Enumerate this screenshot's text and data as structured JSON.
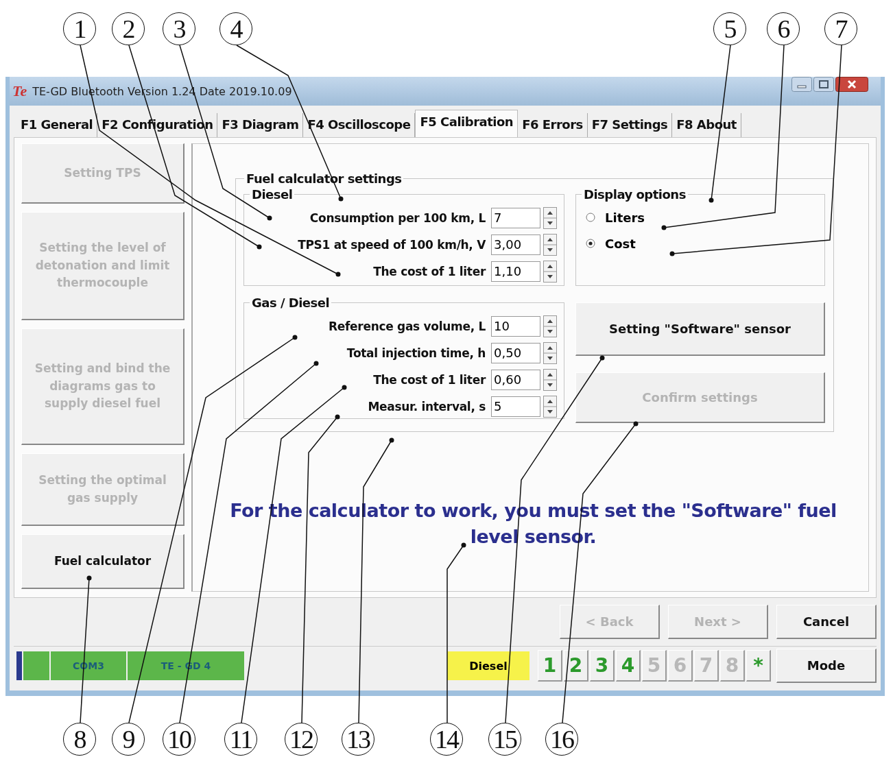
{
  "callouts_top": [
    {
      "label": "1"
    },
    {
      "label": "2"
    },
    {
      "label": "3"
    },
    {
      "label": "4"
    },
    {
      "label": "5"
    },
    {
      "label": "6"
    },
    {
      "label": "7"
    }
  ],
  "callouts_bottom": [
    {
      "label": "8"
    },
    {
      "label": "9"
    },
    {
      "label": "10"
    },
    {
      "label": "11"
    },
    {
      "label": "12"
    },
    {
      "label": "13"
    },
    {
      "label": "14"
    },
    {
      "label": "15"
    },
    {
      "label": "16"
    }
  ],
  "window": {
    "icon_text": "Te",
    "title": "TE-GD Bluetooth Version 1.24  Date 2019.10.09"
  },
  "tabs": [
    {
      "label": "F1 General",
      "selected": false
    },
    {
      "label": "F2 Configuration",
      "selected": false
    },
    {
      "label": "F3 Diagram",
      "selected": false
    },
    {
      "label": "F4 Oscilloscope",
      "selected": false
    },
    {
      "label": "F5 Calibration",
      "selected": true
    },
    {
      "label": "F6 Errors",
      "selected": false
    },
    {
      "label": "F7 Settings",
      "selected": false
    },
    {
      "label": "F8 About",
      "selected": false
    }
  ],
  "sidebar": [
    {
      "label": "Setting TPS",
      "disabled": true
    },
    {
      "label": "Setting the level of detonation and limit thermocouple",
      "disabled": true
    },
    {
      "label": "Setting and bind the diagrams gas to supply diesel fuel",
      "disabled": true
    },
    {
      "label": "Setting the optimal gas supply",
      "disabled": true
    },
    {
      "label": "Fuel calculator",
      "disabled": false
    }
  ],
  "settings": {
    "title": "Fuel calculator settings",
    "diesel": {
      "title": "Diesel",
      "fields": [
        {
          "label": "Consumption per 100 km, L",
          "value": "7"
        },
        {
          "label": "TPS1 at speed of 100 km/h, V",
          "value": "3,00"
        },
        {
          "label": "The cost of 1 liter",
          "value": "1,10"
        }
      ]
    },
    "display_options": {
      "title": "Display options",
      "options": [
        {
          "label": "Liters",
          "selected": false
        },
        {
          "label": "Cost",
          "selected": true
        }
      ]
    },
    "gas_diesel": {
      "title": "Gas / Diesel",
      "fields": [
        {
          "label": "Reference gas volume, L",
          "value": "10"
        },
        {
          "label": "Total injection time, h",
          "value": "0,50"
        },
        {
          "label": "The cost of 1 liter",
          "value": "0,60"
        },
        {
          "label": "Measur. interval, s",
          "value": "5"
        }
      ]
    },
    "buttons": [
      {
        "label": "Setting \"Software\" sensor",
        "disabled": false
      },
      {
        "label": "Confirm settings",
        "disabled": true
      }
    ]
  },
  "message": "For the calculator to work, you must set the \"Software\" fuel level sensor.",
  "nav_buttons": [
    {
      "label": "< Back",
      "disabled": true
    },
    {
      "label": "Next >",
      "disabled": true
    },
    {
      "label": "Cancel",
      "disabled": false
    }
  ],
  "status_bar": {
    "cells": [
      "COM3",
      "TE - GD 4"
    ],
    "mode_indicator": "Diesel",
    "keys": [
      {
        "label": "1",
        "disabled": false
      },
      {
        "label": "2",
        "disabled": false
      },
      {
        "label": "3",
        "disabled": false
      },
      {
        "label": "4",
        "disabled": false
      },
      {
        "label": "5",
        "disabled": true
      },
      {
        "label": "6",
        "disabled": true
      },
      {
        "label": "7",
        "disabled": true
      },
      {
        "label": "8",
        "disabled": true
      },
      {
        "label": "*",
        "disabled": false
      }
    ],
    "mode_button": "Mode"
  }
}
